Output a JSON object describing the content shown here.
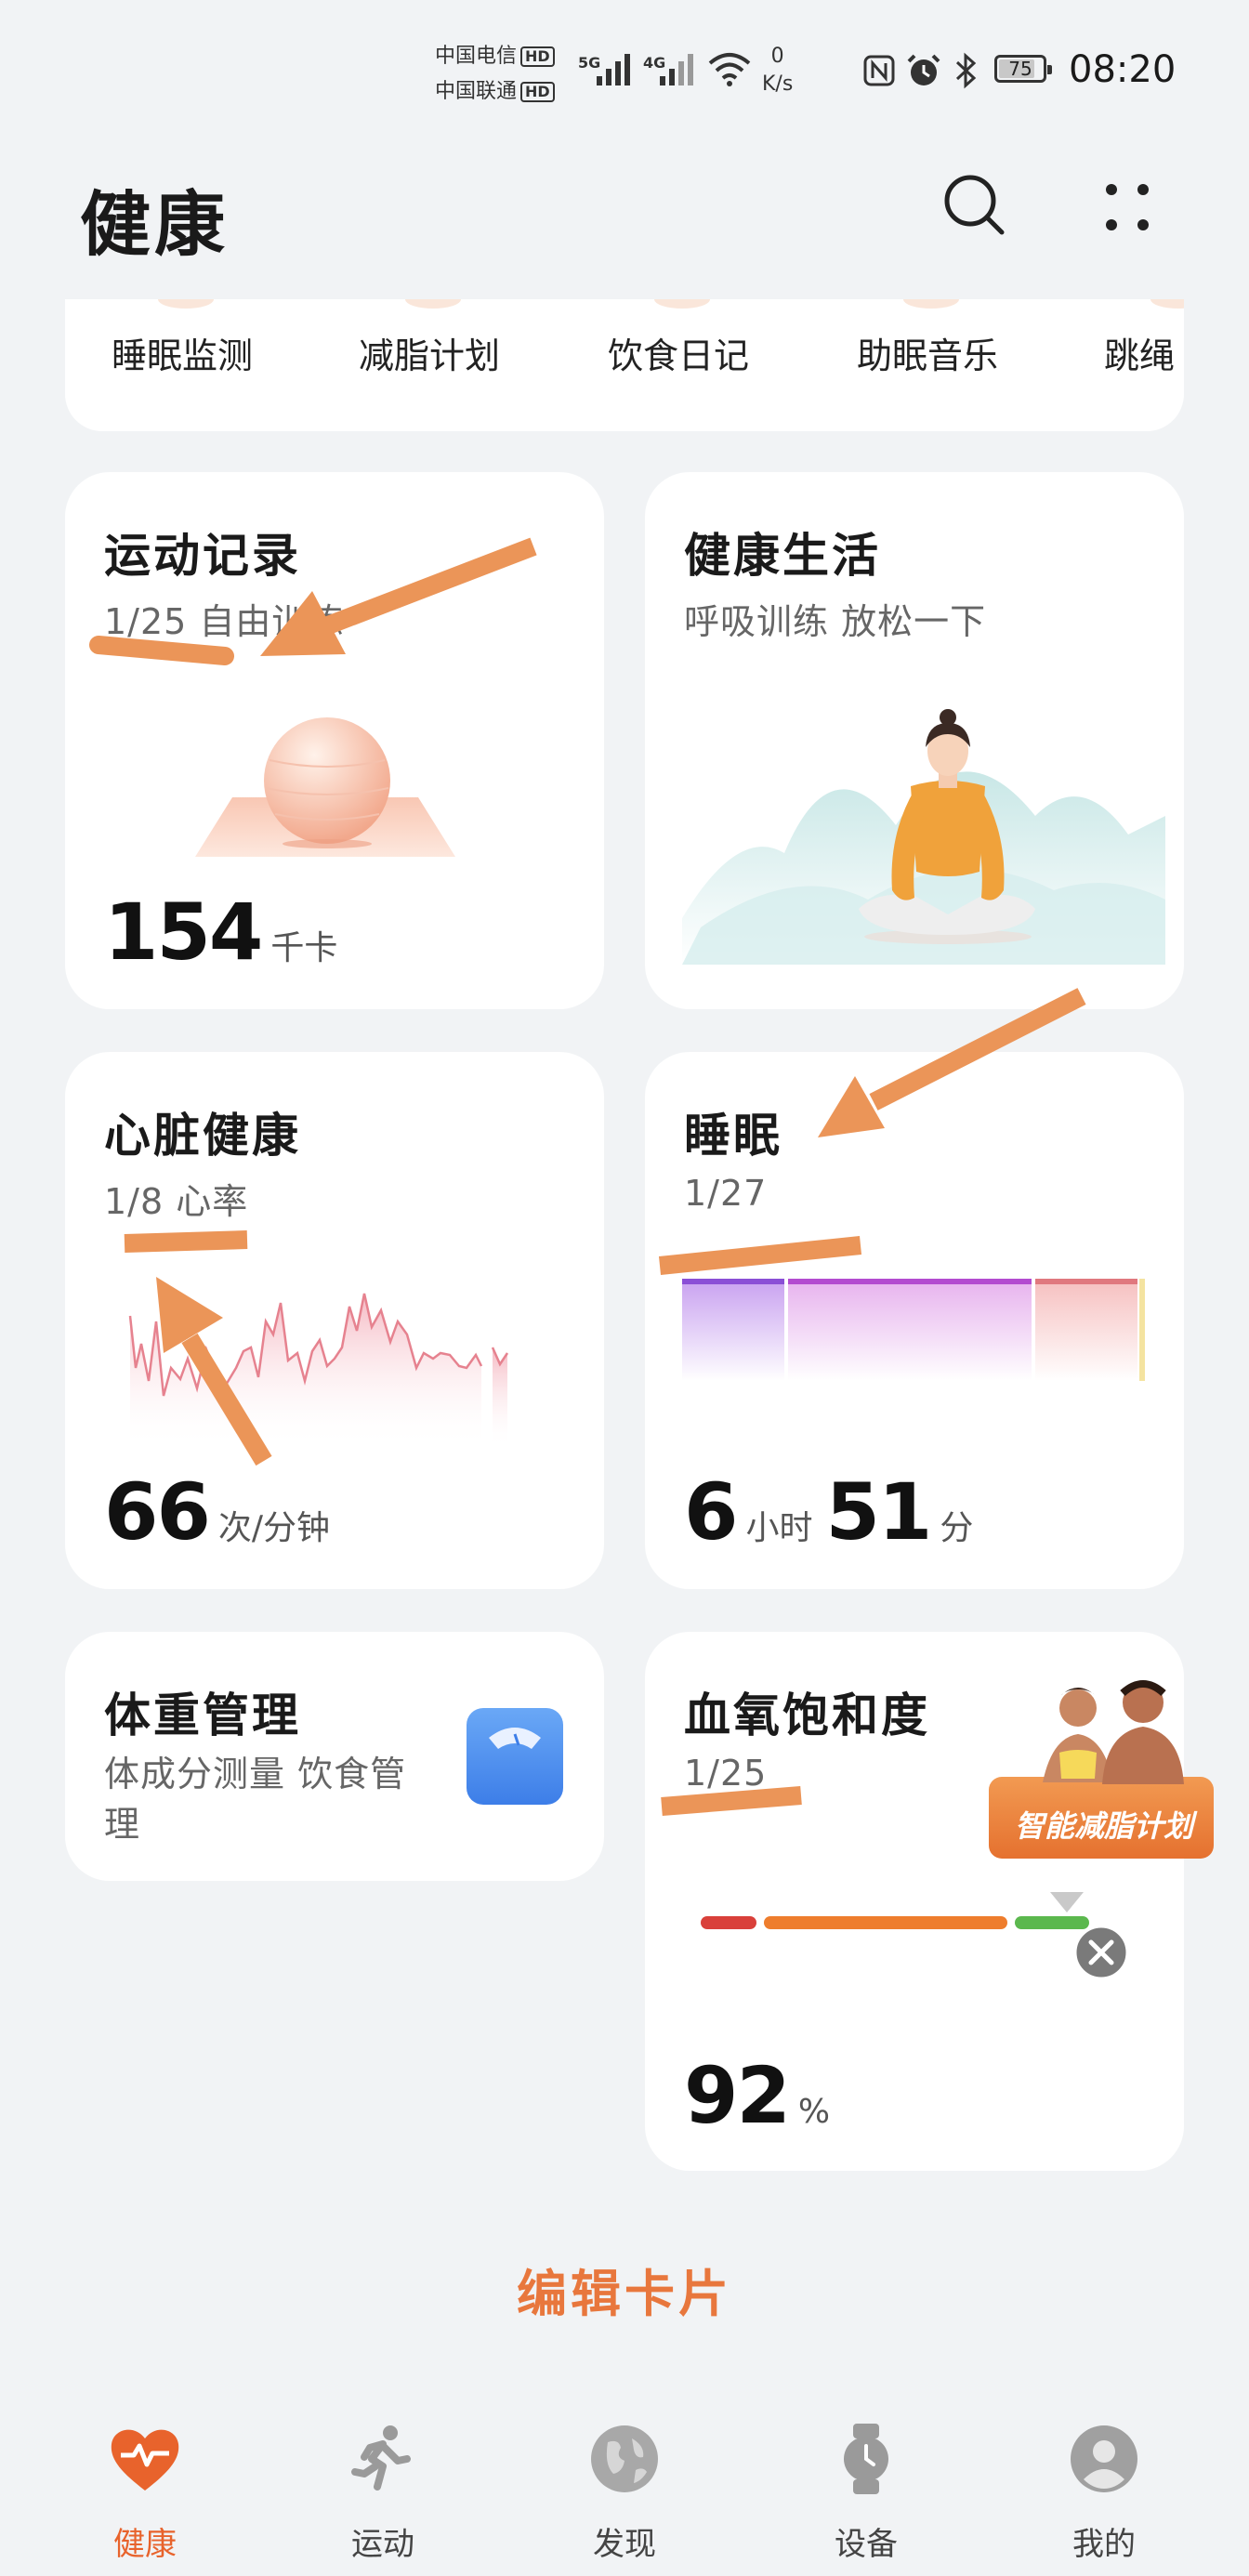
{
  "status_bar": {
    "carrier1": "中国电信",
    "carrier2": "中国联通",
    "hd": "HD",
    "net1": "5G",
    "net2": "4G",
    "speed_value": "0",
    "speed_unit": "K/s",
    "battery": "75",
    "time": "08:20"
  },
  "header": {
    "title": "健康",
    "search_icon": "search-icon",
    "more_icon": "more-dots-icon"
  },
  "shortcuts": [
    "睡眠监测",
    "减脂计划",
    "饮食日记",
    "助眠音乐",
    "跳绳"
  ],
  "cards": {
    "exercise": {
      "title": "运动记录",
      "subtitle": "1/25 自由训练",
      "value": "154",
      "unit": "千卡"
    },
    "healthy_life": {
      "title": "健康生活",
      "subtitle": "呼吸训练 放松一下"
    },
    "heart": {
      "title": "心脏健康",
      "subtitle": "1/8 心率",
      "value": "66",
      "unit": "次/分钟"
    },
    "sleep": {
      "title": "睡眠",
      "subtitle": "1/27",
      "hours": "6",
      "hours_unit": "小时",
      "minutes": "51",
      "minutes_unit": "分"
    },
    "weight": {
      "title": "体重管理",
      "subtitle_line1": "体成分测量 饮食管",
      "subtitle_line2": "理"
    },
    "spo2": {
      "title": "血氧饱和度",
      "subtitle": "1/25",
      "value": "92",
      "unit": "%"
    }
  },
  "ad": {
    "text": "智能减脂计划"
  },
  "edit_cards": "编辑卡片",
  "tabs": [
    {
      "label": "健康",
      "icon": "heart-pulse-icon",
      "active": true
    },
    {
      "label": "运动",
      "icon": "running-icon",
      "active": false
    },
    {
      "label": "发现",
      "icon": "globe-icon",
      "active": false
    },
    {
      "label": "设备",
      "icon": "watch-icon",
      "active": false
    },
    {
      "label": "我的",
      "icon": "profile-icon",
      "active": false
    }
  ],
  "colors": {
    "accent": "#e8632c",
    "annotation": "#eb9558",
    "background": "#f1f3f5",
    "card": "#ffffff"
  }
}
